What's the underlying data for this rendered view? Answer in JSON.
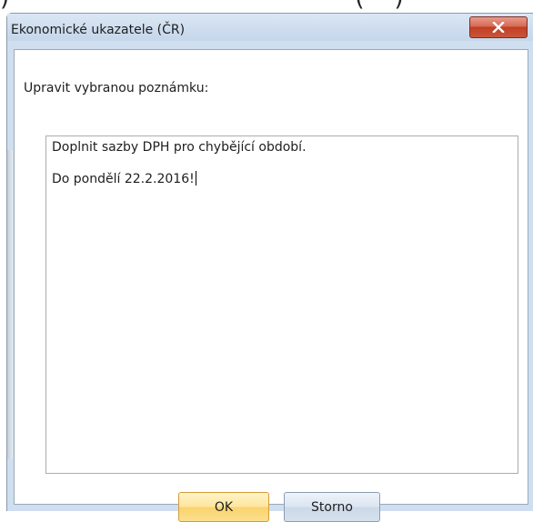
{
  "window": {
    "title": "Ekonomické ukazatele (ČR)"
  },
  "top_strip": {
    "text": ")                                              (    )"
  },
  "dialog": {
    "field_label": "Upravit vybranou poznámku:",
    "note_lines": [
      "Doplnit sazby DPH pro chybějící období.",
      "",
      "Do pondělí 22.2.2016!"
    ]
  },
  "buttons": {
    "ok_label": "OK",
    "cancel_label": "Storno"
  },
  "icons": {
    "close": "close-icon"
  },
  "colors": {
    "titlebar": "#cddcee",
    "close_button": "#c9553a",
    "ok_button": "#fbe08e",
    "cancel_button": "#d6e1ee"
  }
}
